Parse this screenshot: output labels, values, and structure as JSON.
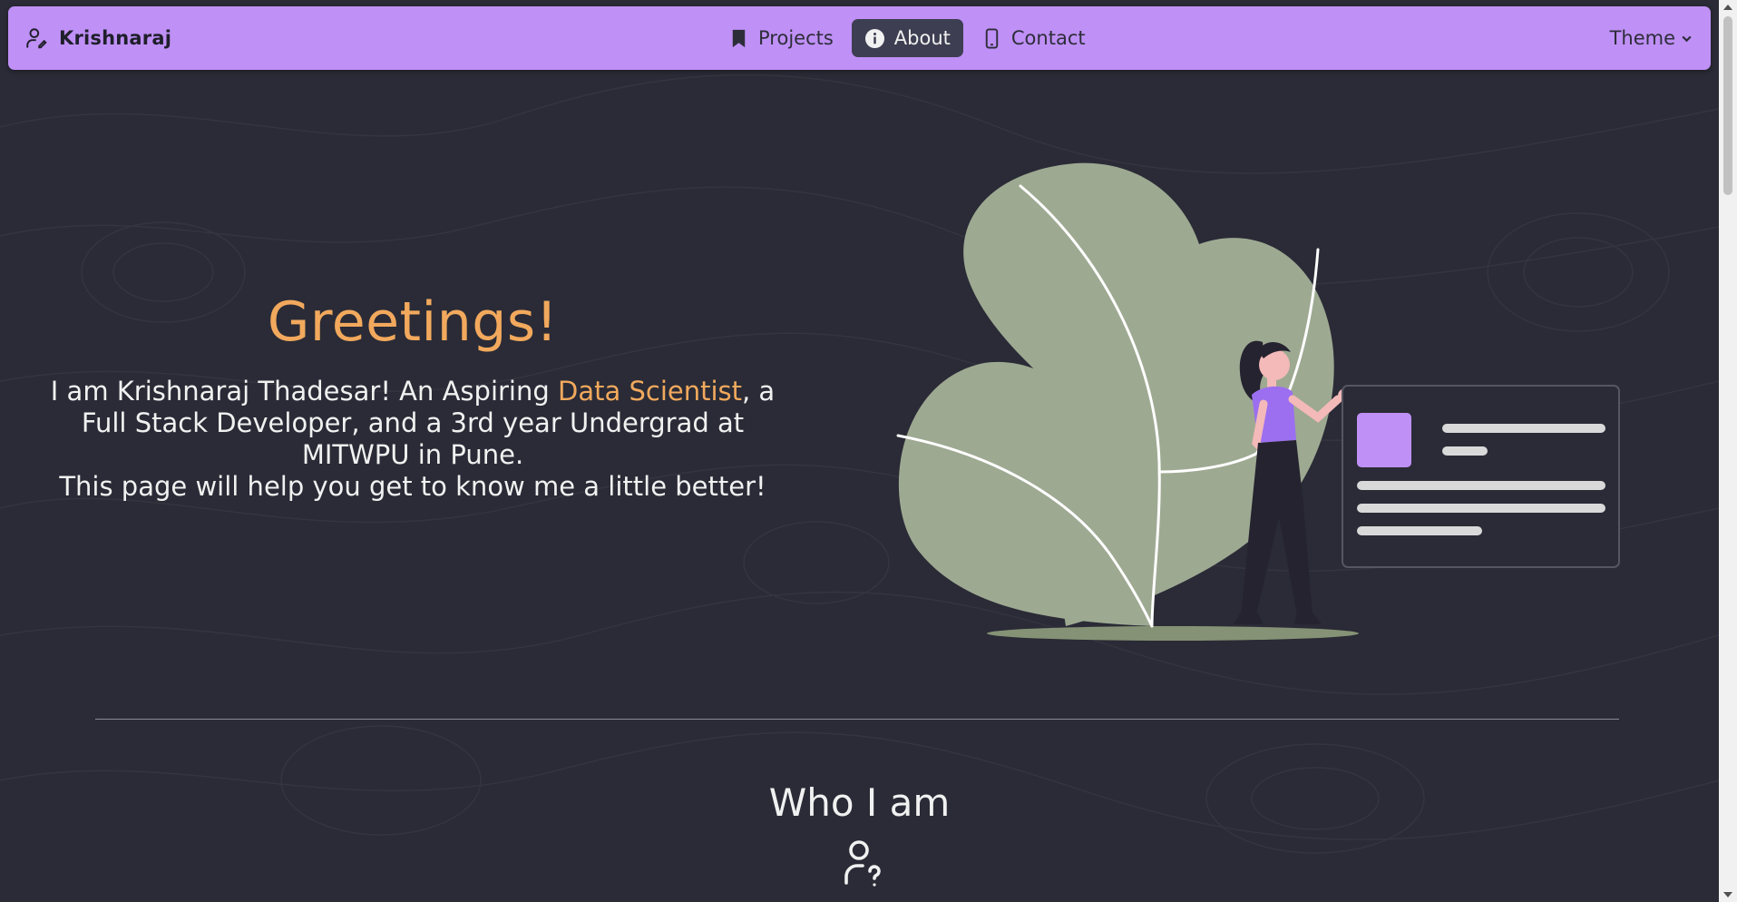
{
  "navbar": {
    "brand": "Krishnaraj",
    "links": [
      {
        "label": "Projects",
        "icon": "bookmark-icon"
      },
      {
        "label": "About",
        "icon": "info-icon"
      },
      {
        "label": "Contact",
        "icon": "phone-icon"
      }
    ],
    "active_link": "About",
    "theme_label": "Theme"
  },
  "hero": {
    "greeting": "Greetings!",
    "intro_before": "I am Krishnaraj Thadesar! An Aspiring ",
    "intro_highlight": "Data Scientist",
    "intro_after": ", a Full Stack Developer, and a 3rd year Undergrad at MITWPU in Pune.",
    "intro_line2": "This page will help you get to know me a little better!"
  },
  "section": {
    "title": "Who I am",
    "icon": "user-question-icon"
  },
  "colors": {
    "navbar_bg": "#bf90f6",
    "page_bg": "#2a2b36",
    "accent": "#f2a95d",
    "leaf": "#9ea992",
    "active_nav_bg": "#3d3e52"
  }
}
